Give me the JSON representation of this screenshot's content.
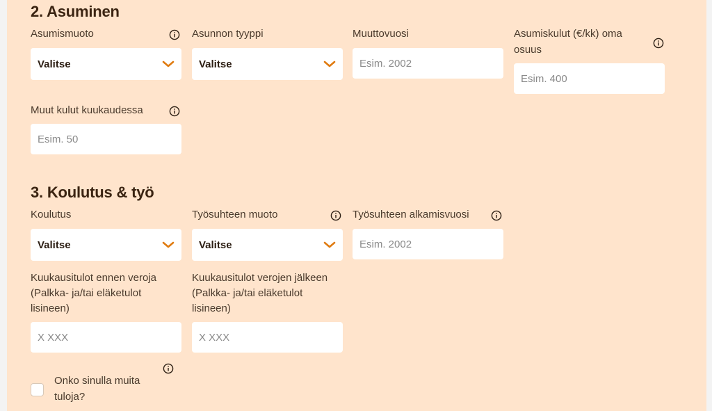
{
  "section2": {
    "title": "2. Asuminen",
    "asumismuoto": {
      "label": "Asumismuoto",
      "value": "Valitse"
    },
    "asunnon_tyyppi": {
      "label": "Asunnon tyyppi",
      "value": "Valitse"
    },
    "muuttovuosi": {
      "label": "Muuttovuosi",
      "placeholder": "Esim. 2002"
    },
    "asumiskulut": {
      "label_line1": "Asumiskulut (€/kk) oma",
      "label_line2": "osuus",
      "placeholder": "Esim. 400"
    },
    "muut_kulut": {
      "label": "Muut kulut kuukaudessa",
      "placeholder": "Esim. 50"
    }
  },
  "section3": {
    "title": "3. Koulutus & työ",
    "koulutus": {
      "label": "Koulutus",
      "value": "Valitse"
    },
    "tyosuhteen_muoto": {
      "label": "Työsuhteen muoto",
      "value": "Valitse"
    },
    "tyosuhteen_alkamisvuosi": {
      "label": "Työsuhteen alkamisvuosi",
      "placeholder": "Esim. 2002"
    },
    "tulot_ennen": {
      "label_line1": "Kuukausitulot ennen veroja",
      "label_line2": "(Palkka- ja/tai eläketulot",
      "label_line3": "lisineen)",
      "placeholder": "X XXX"
    },
    "tulot_jalkeen": {
      "label_line1": "Kuukausitulot verojen jälkeen",
      "label_line2": "(Palkka- ja/tai eläketulot",
      "label_line3": "lisineen)",
      "placeholder": "X XXX"
    },
    "muita_tuloja": {
      "label_line1": "Onko sinulla muita",
      "label_line2": "tuloja?"
    }
  },
  "colors": {
    "panel": "#ffe4cc",
    "accent": "#e07b10",
    "field": "#ffffff",
    "page": "#f3f3f3"
  },
  "icons": {
    "info": "info-circle-icon",
    "chevron": "chevron-down-icon"
  }
}
